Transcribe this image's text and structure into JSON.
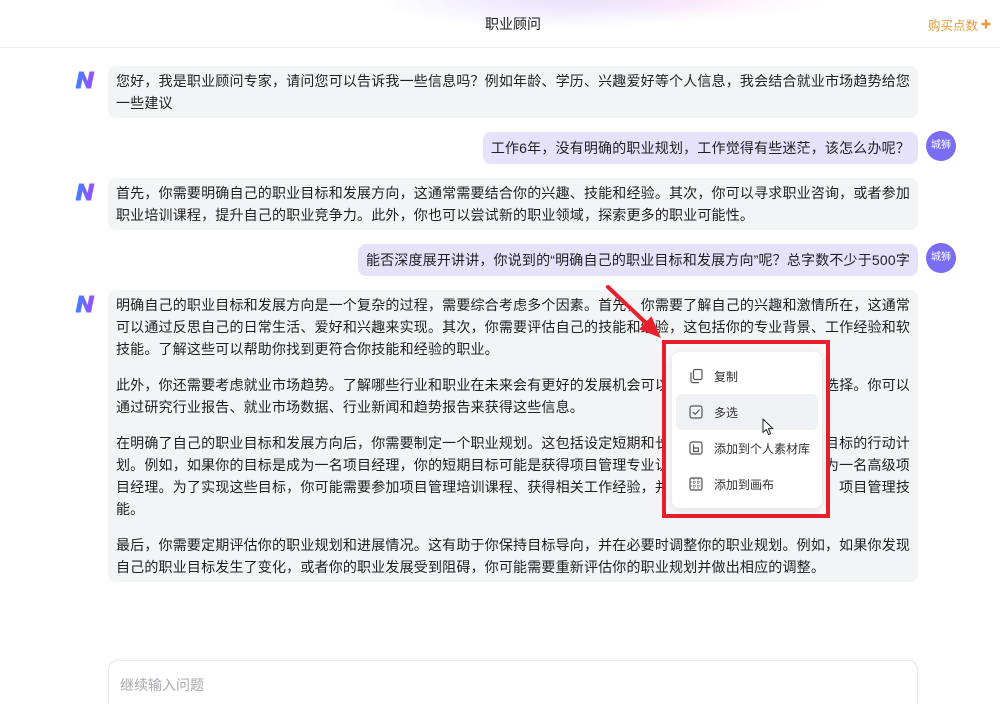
{
  "header": {
    "title": "职业顾问",
    "buy_label": "购买点数",
    "buy_icon": "plus-icon"
  },
  "colors": {
    "buy_orange": "#e69b3a",
    "bot_bubble": "#f3f4f6",
    "user_bubble": "#e7e2fc",
    "avatar_purple": "#7a6cf3",
    "annotation_red": "#e8202e"
  },
  "bot": {
    "avatar_icon": "brand-n-logo-icon"
  },
  "user": {
    "avatar_text": "城狮"
  },
  "messages": [
    {
      "role": "bot",
      "lines": [
        "您好，我是职业顾问专家，请问您可以告诉我一些信息吗？例如年龄、学历、兴趣爱好等个人信息，我会结合就业市场趋势给您",
        "一些建议"
      ]
    },
    {
      "role": "user",
      "lines": [
        "工作6年，没有明确的职业规划，工作觉得有些迷茫，该怎么办呢？"
      ]
    },
    {
      "role": "bot",
      "lines": [
        "首先，你需要明确自己的职业目标和发展方向，这通常需要结合你的兴趣、技能和经验。其次，你可以寻求职业咨询，或者参加",
        "职业培训课程，提升自己的职业竞争力。此外，你也可以尝试新的职业领域，探索更多的职业可能性。"
      ]
    },
    {
      "role": "user",
      "lines": [
        "能否深度展开讲讲，你说到的“明确自己的职业目标和发展方向”呢？总字数不少于500字"
      ]
    },
    {
      "role": "bot",
      "paragraphs": [
        {
          "lines": [
            "明确自己的职业目标和发展方向是一个复杂的过程，需要综合考虑多个因素。首先，你需要了解自己的兴趣和激情所在，这通常",
            "可以通过反思自己的日常生活、爱好和兴趣来实现。其次，你需要评估自己的技能和经验，这包括你的专业背景、工作经验和软",
            "技能。了解这些可以帮助你找到更符合你技能和经验的职业。"
          ]
        },
        {
          "lines": [
            {
              "left": "此外，你还需要考虑就业市场趋势。了解哪些行业和职业在未来会有更好的发展机会可以",
              "right": "选择。你可以"
            },
            "通过研究行业报告、就业市场数据、行业新闻和趋势报告来获得这些信息。"
          ]
        },
        {
          "lines": [
            {
              "left": "在明确了自己的职业目标和发展方向后，你需要制定一个职业规划。这包括设定短期和长",
              "right": "目标的行动计"
            },
            {
              "left": "划。例如，如果你的目标是成为一名项目经理，你的短期目标可能是获得项目管理专业认",
              "right": "为一名高级项"
            },
            {
              "left": "目经理。为了实现这些目标，你可能需要参加项目管理培训课程、获得相关工作经验，并",
              "right": "项目管理技"
            },
            "能。"
          ]
        },
        {
          "lines": [
            "最后，你需要定期评估你的职业规划和进展情况。这有助于你保持目标导向，并在必要时调整你的职业规划。例如，如果你发现",
            "自己的职业目标发生了变化，或者你的职业发展受到阻碍，你可能需要重新评估你的职业规划并做出相应的调整。"
          ]
        }
      ]
    }
  ],
  "context_menu": {
    "items": [
      {
        "label": "复制",
        "icon": "copy-icon"
      },
      {
        "label": "多选",
        "icon": "checkbox-icon",
        "hovered": true
      },
      {
        "label": "添加到个人素材库",
        "icon": "library-icon"
      },
      {
        "label": "添加到画布",
        "icon": "canvas-grid-icon"
      }
    ]
  },
  "input": {
    "placeholder": "继续输入问题"
  }
}
